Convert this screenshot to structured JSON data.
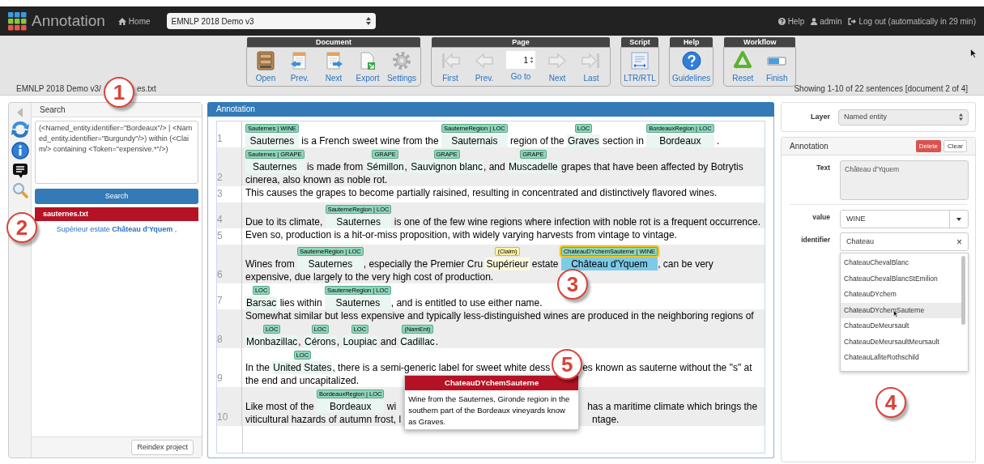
{
  "navbar": {
    "brand": "Annotation",
    "home": "Home",
    "project": "EMNLP 2018 Demo v3",
    "help": "Help",
    "user": "admin",
    "logout": "Log out (automatically in 29 min)"
  },
  "toolbar": [
    {
      "title": "Document",
      "items": [
        {
          "kind": "open",
          "label": "Open"
        },
        {
          "kind": "prev",
          "label": "Prev."
        },
        {
          "kind": "next",
          "label": "Next"
        },
        {
          "kind": "export",
          "label": "Export"
        },
        {
          "kind": "settings",
          "label": "Settings"
        }
      ]
    },
    {
      "title": "Page",
      "items": [
        {
          "kind": "first",
          "label": "First"
        },
        {
          "kind": "prev-page",
          "label": "Prev."
        },
        {
          "kind": "goto",
          "label": "Go to",
          "value": "1"
        },
        {
          "kind": "next-page",
          "label": "Next"
        },
        {
          "kind": "last",
          "label": "Last"
        }
      ]
    },
    {
      "title": "Script",
      "items": [
        {
          "kind": "script",
          "label": "LTR/RTL"
        }
      ]
    },
    {
      "title": "Help",
      "items": [
        {
          "kind": "guidelines",
          "label": "Guidelines"
        }
      ]
    },
    {
      "title": "Workflow",
      "items": [
        {
          "kind": "reset",
          "label": "Reset"
        },
        {
          "kind": "finish",
          "label": "Finish"
        }
      ]
    }
  ],
  "breadcrumb": {
    "parts": [
      "EMNLP 2018 Demo v3/",
      "es.txt"
    ]
  },
  "showing": "Showing 1-10 of 22 sentences [document 2 of 4]",
  "search_panel": {
    "title": "Search",
    "query": "(<Named_entity.identifier=\"Bordeaux\"/> | <Named_entity.identifier=\"Burgundy\"/>) within (<Claim/> containing <Token=\"expensive.*\"/>)",
    "button": "Search",
    "result_file": "sauternes.txt",
    "result": "Supérieur estate **Château d'Yquem** ,",
    "reindex": "Reindex project"
  },
  "annotation_panel": {
    "title": "Annotation",
    "sentences": [
      {
        "number": "1",
        "segments": [
          {
            "kind": "entity",
            "text": "Sauternes",
            "label": "Sauternes | WINE",
            "selected": false
          },
          {
            "kind": "text",
            "text": " is a French sweet wine from the "
          },
          {
            "kind": "entity",
            "text": "Sauternais",
            "label": "SauterneRegion | LOC",
            "selected": false
          },
          {
            "kind": "text",
            "text": " region of the "
          },
          {
            "kind": "entity",
            "text": "Graves",
            "label": "LOC",
            "selected": false
          },
          {
            "kind": "text",
            "text": " section in "
          },
          {
            "kind": "entity",
            "text": "Bordeaux",
            "label": "BordeauxRegion | LOC",
            "selected": false
          },
          {
            "kind": "text",
            "text": " ."
          }
        ]
      },
      {
        "number": "2",
        "segments": [
          {
            "kind": "entity",
            "text": "Sauternes",
            "label": "Sauternes | GRAPE",
            "selected": false
          },
          {
            "kind": "text",
            "text": " is made from "
          },
          {
            "kind": "entity",
            "text": "Sémillon",
            "label": "GRAPE",
            "selected": false
          },
          {
            "kind": "text",
            "text": ", "
          },
          {
            "kind": "entity",
            "text": "Sauvignon blanc",
            "label": "GRAPE",
            "selected": false
          },
          {
            "kind": "text",
            "text": ", and "
          },
          {
            "kind": "entity",
            "text": "Muscadelle",
            "label": "GRAPE",
            "selected": false
          },
          {
            "kind": "text",
            "text": " grapes that have been affected by Botrytis cinerea, also known as noble rot."
          }
        ]
      },
      {
        "number": "3",
        "segments": [
          {
            "kind": "text",
            "text": "This causes the grapes to become partially raisined, resulting in concentrated and distinctively flavored wines."
          }
        ]
      },
      {
        "number": "4",
        "segments": [
          {
            "kind": "text",
            "text": "Due to its climate, "
          },
          {
            "kind": "entity",
            "text": "Sauternes",
            "label": "SauterneRegion | LOC",
            "selected": false
          },
          {
            "kind": "text",
            "text": " is one of the few wine regions where infection with noble rot is a frequent occurrence."
          }
        ]
      },
      {
        "number": "5",
        "segments": [
          {
            "kind": "text",
            "text": "Even so, production is a hit-or-miss proposition, with widely varying harvests from vintage to vintage."
          }
        ]
      },
      {
        "number": "6",
        "segments": [
          {
            "kind": "text",
            "text": "Wines from "
          },
          {
            "kind": "entity",
            "text": "Sauternes",
            "label": "SauterneRegion | LOC",
            "selected": false
          },
          {
            "kind": "text",
            "text": ", especially the Premier Cru "
          },
          {
            "kind": "claim",
            "text": "Supérieur",
            "label": "(Claim)",
            "selected": false
          },
          {
            "kind": "text",
            "text": " estate "
          },
          {
            "kind": "entity",
            "text": "Château d'Yquem",
            "label": "ChateauDYchemSauterne | WINE",
            "selected": true
          },
          {
            "kind": "text",
            "text": ", can be very expensive, due largely to the very high cost of production."
          }
        ]
      },
      {
        "number": "7",
        "segments": [
          {
            "kind": "entity",
            "text": "Barsac",
            "label": "LOC",
            "selected": false
          },
          {
            "kind": "text",
            "text": " lies within "
          },
          {
            "kind": "entity",
            "text": "Sauternes",
            "label": "SauterneRegion | LOC",
            "selected": false
          },
          {
            "kind": "text",
            "text": ", and is entitled to use either name."
          }
        ]
      },
      {
        "number": "8",
        "segments": [
          {
            "kind": "text",
            "text": "Somewhat similar but less expensive and typically less-distinguished wines are produced in the neighboring regions of "
          },
          {
            "kind": "entity",
            "text": "Monbazillac",
            "label": "LOC",
            "selected": false
          },
          {
            "kind": "text",
            "text": ", "
          },
          {
            "kind": "entity",
            "text": "Cérons",
            "label": "LOC",
            "selected": false
          },
          {
            "kind": "text",
            "text": ", "
          },
          {
            "kind": "entity",
            "text": "Loupiac",
            "label": "LOC",
            "selected": false
          },
          {
            "kind": "text",
            "text": " and "
          },
          {
            "kind": "entity",
            "text": "Cadillac",
            "label": "(NamEnt)",
            "selected": false
          },
          {
            "kind": "text",
            "text": "."
          }
        ]
      },
      {
        "number": "9",
        "segments": [
          {
            "kind": "text",
            "text": "In the "
          },
          {
            "kind": "entity",
            "text": "United States",
            "label": "LOC",
            "selected": false
          },
          {
            "kind": "text",
            "text": ", there is a semi-generic label for sweet white dess"
          },
          {
            "kind": "callout-gap"
          },
          {
            "kind": "text",
            "text": "es known as sauterne without the \"s\" at the end and uncapitalized."
          }
        ]
      },
      {
        "number": "10",
        "segments": [
          {
            "kind": "text",
            "text": "Like most of the "
          },
          {
            "kind": "entity",
            "text": "Bordeaux",
            "label": "BordeauxRegion | LOC",
            "selected": false
          },
          {
            "kind": "text",
            "text": " wi"
          },
          {
            "kind": "tooltip-gap"
          },
          {
            "kind": "text",
            "text": "has a maritime climate which brings the"
          },
          {
            "kind": "break"
          },
          {
            "kind": "text",
            "text": "viticultural hazards of autumn frost, l"
          },
          {
            "kind": "tooltip-gap"
          },
          {
            "kind": "text",
            "text": "ntage."
          }
        ]
      }
    ],
    "tooltip": {
      "title": "ChateauDYchemSauterne",
      "text": "Wine from the Sauternes, Gironde region in the southern part of the Bordeaux vineyards know as Graves."
    }
  },
  "layer": {
    "label": "Layer",
    "value": "Named entity"
  },
  "editor": {
    "title": "Annotation",
    "delete": "Delete",
    "clear": "Clear",
    "text_label": "Text",
    "text": "Château d'Yquem",
    "value_label": "value",
    "value": "WINE",
    "identifier_label": "identifier",
    "identifier": "Chateau",
    "clear_glyph": "×",
    "suggestions": [
      {
        "text": "ChateauChevalBlanc",
        "selected": false
      },
      {
        "text": "ChateauChevalBlancStEmilion",
        "selected": false
      },
      {
        "text": "ChateauDYchem",
        "selected": false
      },
      {
        "text": "ChateauDYchemSauterne",
        "selected": true
      },
      {
        "text": "ChateauDeMeursault",
        "selected": false
      },
      {
        "text": "ChateauDeMeursaultMeursault",
        "selected": false
      },
      {
        "text": "ChateauLafiteRothschild",
        "selected": false
      }
    ]
  },
  "callouts": [
    {
      "number": "1"
    },
    {
      "number": "2"
    },
    {
      "number": "3"
    },
    {
      "number": "4"
    },
    {
      "number": "5"
    }
  ]
}
